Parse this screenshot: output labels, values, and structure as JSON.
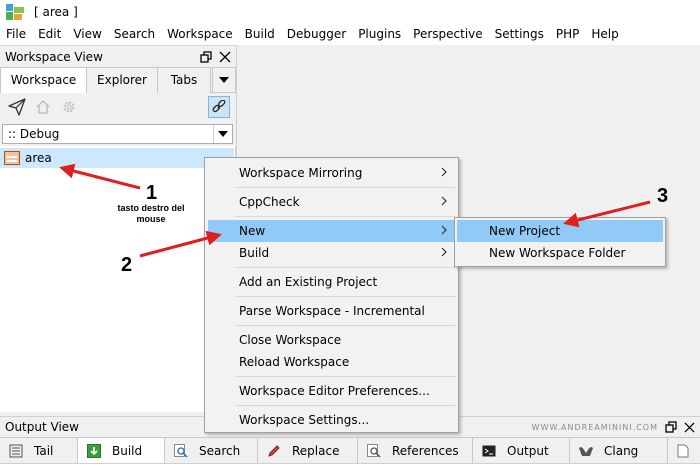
{
  "window": {
    "title": "[ area ]"
  },
  "menubar": [
    "File",
    "Edit",
    "View",
    "Search",
    "Workspace",
    "Build",
    "Debugger",
    "Plugins",
    "Perspective",
    "Settings",
    "PHP",
    "Help"
  ],
  "workspace_view": {
    "title": "Workspace View",
    "tabs": [
      "Workspace",
      "Explorer",
      "Tabs"
    ],
    "active_tab": "Workspace",
    "toolbar_icons": [
      "send-icon",
      "home-icon",
      "gear-icon",
      "link-icon"
    ],
    "config": ":: Debug",
    "tree": [
      {
        "label": "area",
        "icon": "workspace-icon"
      }
    ]
  },
  "context_menu": {
    "items": [
      {
        "label": "Workspace Mirroring",
        "submenu": true
      },
      {
        "label": "CppCheck",
        "submenu": true
      },
      {
        "label": "New",
        "submenu": true,
        "highlighted": true
      },
      {
        "label": "Build",
        "submenu": true
      },
      {
        "label": "Add an Existing Project",
        "submenu": false
      },
      {
        "label": "Parse Workspace - Incremental",
        "submenu": false
      },
      {
        "label": "Close Workspace",
        "submenu": false
      },
      {
        "label": "Reload Workspace",
        "submenu": false
      },
      {
        "label": "Workspace Editor Preferences...",
        "submenu": false
      },
      {
        "label": "Workspace Settings...",
        "submenu": false
      }
    ]
  },
  "submenu_new": {
    "items": [
      {
        "label": "New Project",
        "highlighted": true
      },
      {
        "label": "New Workspace Folder",
        "highlighted": false
      }
    ]
  },
  "output_view": {
    "title": "Output View",
    "watermark": "WWW.ANDREAMININI.COM",
    "tabs": [
      {
        "label": "Tail",
        "icon": "list-icon"
      },
      {
        "label": "Build",
        "icon": "build-icon",
        "active": true
      },
      {
        "label": "Search",
        "icon": "search-icon"
      },
      {
        "label": "Replace",
        "icon": "pencil-icon"
      },
      {
        "label": "References",
        "icon": "references-icon"
      },
      {
        "label": "Output",
        "icon": "terminal-icon"
      },
      {
        "label": "Clang",
        "icon": "clang-icon"
      }
    ]
  },
  "annotations": {
    "step1": "1",
    "step1_note": "tasto destro del mouse",
    "step2": "2",
    "step3": "3",
    "arrow_color": "#e01e1e"
  }
}
